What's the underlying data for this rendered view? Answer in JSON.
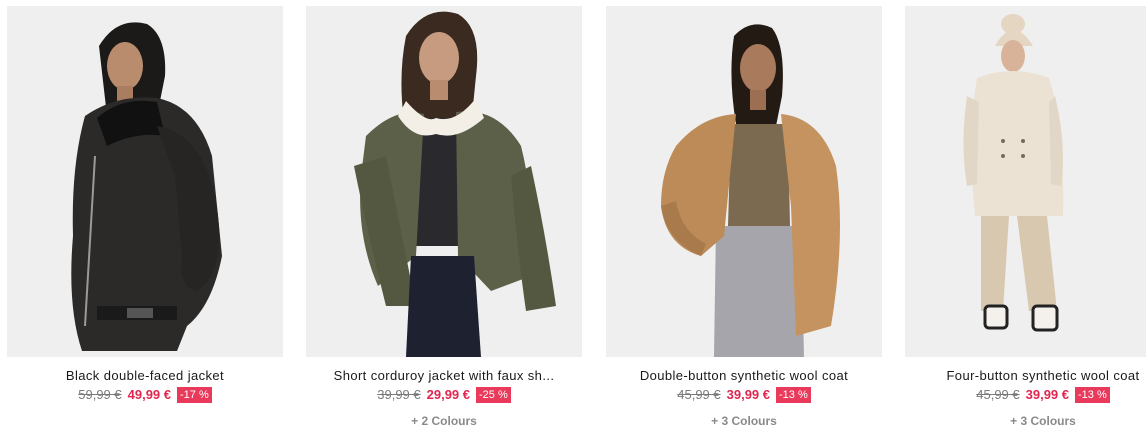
{
  "products": [
    {
      "name": "Black double-faced jacket",
      "old_price": "59,99 €",
      "price": "49,99 €",
      "discount": "-17 %",
      "colours": "",
      "image": "model-black-jacket-photo"
    },
    {
      "name": "Short corduroy jacket with faux sh...",
      "old_price": "39,99 €",
      "price": "29,99 €",
      "discount": "-25 %",
      "colours": "+ 2 Colours",
      "image": "model-khaki-corduroy-jacket-photo"
    },
    {
      "name": "Double-button synthetic wool coat",
      "old_price": "45,99 €",
      "price": "39,99 €",
      "discount": "-13 %",
      "colours": "+ 3 Colours",
      "image": "model-camel-coat-photo"
    },
    {
      "name": "Four-button synthetic wool coat",
      "old_price": "45,99 €",
      "price": "39,99 €",
      "discount": "-13 %",
      "colours": "+ 3 Colours",
      "image": "model-cream-coat-photo"
    }
  ],
  "colors": {
    "sale_price": "#e0264f",
    "discount_badge": "#e93a5c",
    "photo_background": "#efefef"
  }
}
